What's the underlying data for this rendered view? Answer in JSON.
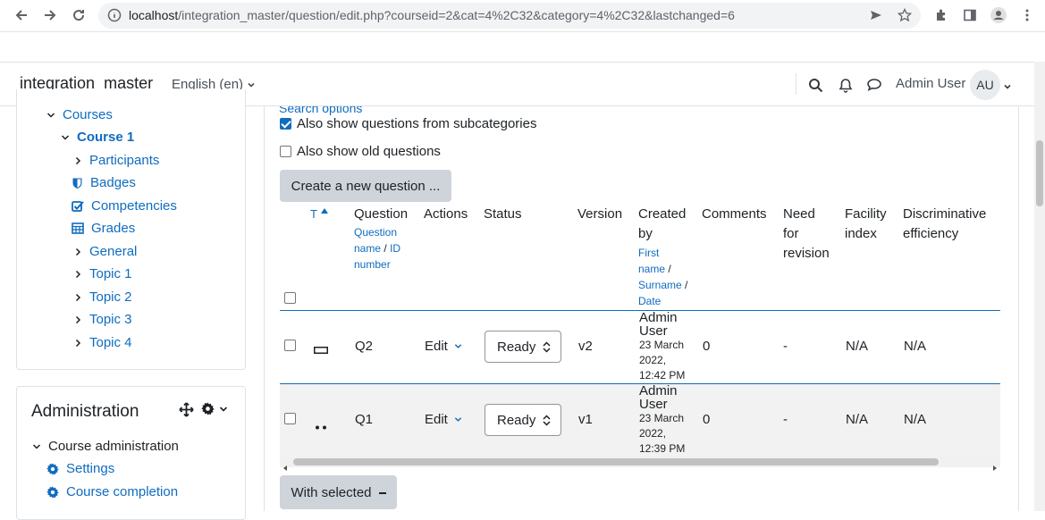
{
  "browser": {
    "url_host": "localhost",
    "url_path": "/integration_master/question/edit.php?courseid=2&cat=4%2C32&category=4%2C32&lastchanged=6"
  },
  "header": {
    "site_name": "integration_master",
    "language": "English (en)",
    "user_name": "Admin User",
    "avatar_initials": "AU"
  },
  "navigation": {
    "courses": "Courses",
    "course": "Course 1",
    "items": [
      {
        "label": "Participants",
        "icon": "chevron-right-icon"
      },
      {
        "label": "Badges",
        "icon": "shield-icon"
      },
      {
        "label": "Competencies",
        "icon": "checkbox-icon"
      },
      {
        "label": "Grades",
        "icon": "table-icon"
      },
      {
        "label": "General",
        "icon": "chevron-right-icon"
      },
      {
        "label": "Topic 1",
        "icon": "chevron-right-icon"
      },
      {
        "label": "Topic 2",
        "icon": "chevron-right-icon"
      },
      {
        "label": "Topic 3",
        "icon": "chevron-right-icon"
      },
      {
        "label": "Topic 4",
        "icon": "chevron-right-icon"
      }
    ]
  },
  "administration": {
    "title": "Administration",
    "section": "Course administration",
    "items": [
      "Settings",
      "Course completion"
    ]
  },
  "main": {
    "search_options": "Search options",
    "show_subcategories": {
      "label": "Also show questions from subcategories",
      "checked": true
    },
    "show_old": {
      "label": "Also show old questions",
      "checked": false
    },
    "create_button": "Create a new question ...",
    "with_selected": "With selected"
  },
  "table": {
    "headers": {
      "type": "T",
      "question": "Question",
      "question_name": "Question name",
      "sep": "/",
      "id_number": "ID number",
      "actions": "Actions",
      "status": "Status",
      "version": "Version",
      "created_by_1": "Created",
      "created_by_2": "by",
      "first_name": "First name",
      "surname": "Surname",
      "date": "Date",
      "comments": "Comments",
      "need_1": "Need",
      "need_2": "for",
      "need_3": "revision",
      "facility_1": "Facility",
      "facility_2": "index",
      "disc_1": "Discriminative",
      "disc_2": "efficiency"
    },
    "rows": [
      {
        "name": "Q2",
        "action": "Edit",
        "status": "Ready",
        "version": "v2",
        "creator_1": "Admin",
        "creator_2": "User",
        "date_1": "23 March",
        "date_2": "2022,",
        "date_3": "12:42 PM",
        "comments": "0",
        "need": "-",
        "facility": "N/A",
        "disc": "N/A"
      },
      {
        "name": "Q1",
        "action": "Edit",
        "status": "Ready",
        "version": "v1",
        "creator_1": "Admin",
        "creator_2": "User",
        "date_1": "23 March",
        "date_2": "2022,",
        "date_3": "12:39 PM",
        "comments": "0",
        "need": "-",
        "facility": "N/A",
        "disc": "N/A"
      }
    ]
  }
}
